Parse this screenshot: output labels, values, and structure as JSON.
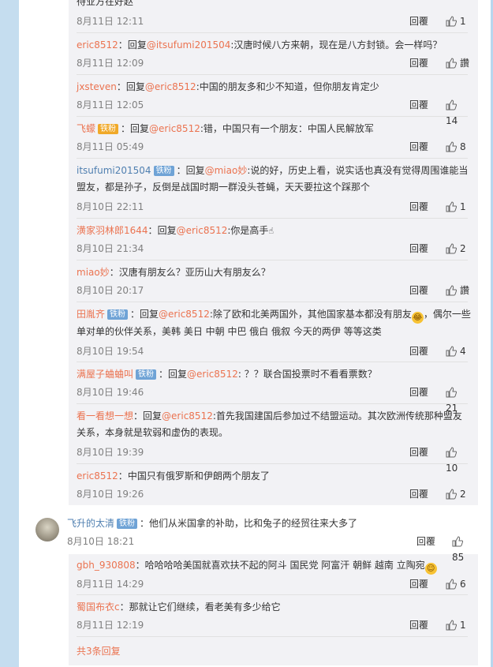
{
  "top": {
    "time": "8月11日 12:11",
    "reply": "回覆",
    "likes": "1",
    "cut_text": "待业方在好赵"
  },
  "comments": [
    {
      "user": "eric8512",
      "sep": "：",
      "pre": "回复",
      "mention": "@itsufumi201504",
      "text": ":汉唐时候八方来朝，现在是八方封锁。会一样吗？",
      "time": "8月11日 12:09",
      "reply": "回覆",
      "likes": "讚"
    },
    {
      "user": "jxsteven",
      "sep": "：",
      "pre": "回复",
      "mention": "@eric8512",
      "text": ":中国的朋友多和少不知道，但你朋友肯定少",
      "time": "8月11日 12:05",
      "reply": "回覆",
      "likes": "14"
    },
    {
      "user": "飞蠓",
      "badge": "铁粉",
      "sep": "：",
      "pre": "回复",
      "mention": "@eric8512",
      "text": ":错，中国只有一个朋友：中国人民解放军",
      "time": "8月11日 05:49",
      "reply": "回覆",
      "likes": "8"
    },
    {
      "user": "itsufumi201504",
      "badge": "铁粉",
      "sep": "：",
      "pre": "回复",
      "mention": "@miao妙",
      "text": ":说的好，历史上看，说实话也真没有觉得周围谁能当盟友，都是孙子，反倒是战国时期一群没头苍蝇，天天要拉这个踩那个",
      "time": "8月10日 22:11",
      "reply": "回覆",
      "likes": "1"
    },
    {
      "user": "潢家羽林郎1644",
      "sep": "：",
      "pre": "回复",
      "mention": "@eric8512",
      "text": ":你是高手",
      "time": "8月10日 21:34",
      "reply": "回覆",
      "likes": "2"
    },
    {
      "user": "miao妙",
      "sep": "：",
      "text": "汉唐有朋友么？亚历山大有朋友么？",
      "time": "8月10日 20:17",
      "reply": "回覆",
      "likes": "讚"
    },
    {
      "user": "田胤齐",
      "badge": "铁粉",
      "sep": "：",
      "pre": "回复",
      "mention": "@eric8512",
      "text": ":除了欧和北美两国外，其他国家基本都没有朋友",
      "text2": "，偶尔一些单对单的伙伴关系，美韩 美日 中朝 中巴 俄白 俄叙 今天的两伊 等等这类",
      "time": "8月10日 19:54",
      "reply": "回覆",
      "likes": "4"
    },
    {
      "user": "满屋子蛐蛐叫",
      "badge": "铁粉",
      "sep": "：",
      "pre": "回复",
      "mention": "@eric8512",
      "text": ": ？？联合国投票时不看看票数？",
      "time": "8月10日 19:46",
      "reply": "回覆",
      "likes": "21"
    },
    {
      "user": "看一看想一想",
      "sep": "：",
      "pre": "回复",
      "mention": "@eric8512",
      "text": ":首先我国建国后参加过不结盟运动。其次欧洲传统那种盟友关系，本身就是软弱和虚伪的表现。",
      "time": "8月10日 19:39",
      "reply": "回覆",
      "likes": "10"
    },
    {
      "user": "eric8512",
      "sep": "：",
      "text": "中国只有俄罗斯和伊朗两个朋友了",
      "time": "8月10日 19:26",
      "reply": "回覆",
      "likes": "2"
    }
  ],
  "main": {
    "user": "飞升的太清",
    "badge": "铁粉",
    "sep": "：",
    "text": "他们从米国拿的补助，比和兔子的经贸往来大多了",
    "time": "8月10日 18:21",
    "reply": "回覆",
    "likes": "85"
  },
  "replies": [
    {
      "user": "gbh_930808",
      "sep": "：",
      "text": "哈哈哈哈美国就喜欢扶不起的阿斗 国民党 阿富汗 朝鲜 越南 立陶宛",
      "time": "8月11日 14:29",
      "reply": "回覆",
      "likes": "6"
    },
    {
      "user": "蜀国布衣c",
      "sep": "：",
      "text": "那就让它们继续，看老美有多少给它",
      "time": "8月11日 12:19",
      "reply": "回覆",
      "likes": "1"
    }
  ],
  "total_replies": "共3条回复",
  "colors": {
    "accent": "#eb7350",
    "link": "#4f7fb0",
    "badge": "#6fa3d6",
    "panel": "#f2f2f5"
  }
}
